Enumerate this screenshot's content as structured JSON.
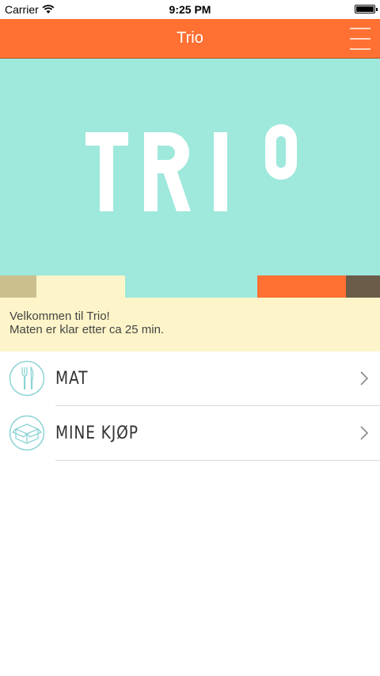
{
  "status_bar": {
    "carrier": "Carrier",
    "time": "9:25 PM"
  },
  "nav": {
    "title": "Trio"
  },
  "logo": {
    "text": "TRIO"
  },
  "welcome": {
    "line1": "Velkommen til Trio!",
    "line2": "Maten er klar etter ca 25 min."
  },
  "menu": [
    {
      "label": "MAT",
      "icon": "cutlery-icon"
    },
    {
      "label": "MINE KJØP",
      "icon": "box-icon"
    }
  ],
  "colors": {
    "nav_orange": "#ff7033",
    "hero_mint": "#9ee8dc",
    "welcome_cream": "#fdf5c9",
    "icon_teal": "#8cd3d3",
    "strip_tan": "#cbbf8e",
    "strip_brown": "#6b5b49"
  }
}
